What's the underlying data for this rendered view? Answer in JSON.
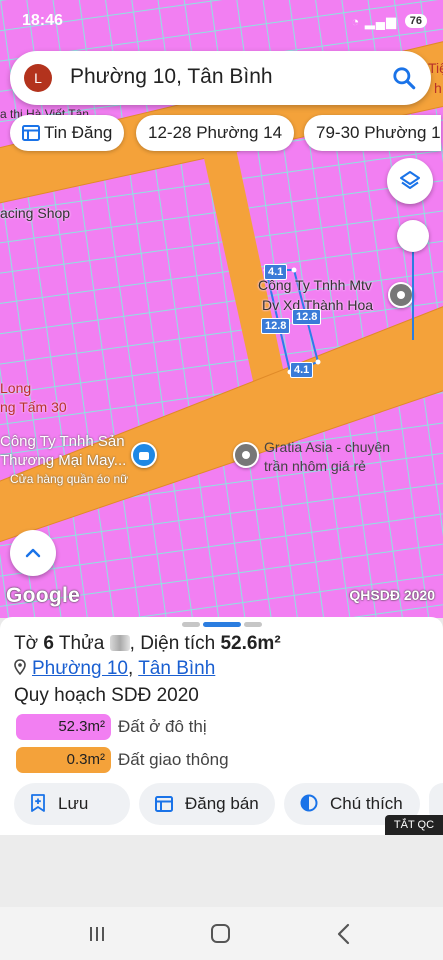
{
  "status_bar": {
    "time": "18:46",
    "battery": "76"
  },
  "search": {
    "avatar_letter": "L",
    "query": "Phường 10, Tân Bình"
  },
  "chips": [
    {
      "label": "Tin Đăng",
      "icon": "listing-icon"
    },
    {
      "label": "12-28 Phường 14"
    },
    {
      "label": "79-30 Phường 1"
    }
  ],
  "map": {
    "labels": {
      "street_top": "a thị Hà Viết Tân",
      "racing_shop": "acing Shop",
      "company_1_line1": "Công Ty Tnhh Mtv",
      "company_1_line2": "Dv Xd Thành Hoa",
      "long": "Long",
      "com_tam": "ng Tấm 30",
      "company_2_line1": "Công Ty Tnhh Sản",
      "company_2_line2": "Thương Mại May...",
      "clothes_shop": "Cửa hàng quần áo nữ",
      "gratia_line1": "Gratia Asia - chuyên",
      "gratia_line2": "trần nhôm giá rẻ",
      "edge_top": "Tiệ",
      "edge_mid": "h"
    },
    "dimensions": {
      "top": "4.1",
      "left": "12.8",
      "right": "12.8",
      "bottom": "4.1"
    },
    "google_logo": "Google",
    "layer_badge": "QHSDĐ 2020"
  },
  "sheet": {
    "to_label": "Tờ",
    "to_number": "6",
    "thua_label": "Thửa",
    "area_label": "Diện tích",
    "area_value": "52.6m²",
    "ward": "Phường 10",
    "separator": ",",
    "district": "Tân Bình",
    "plan_title": "Quy hoạch SDĐ 2020",
    "land_uses": [
      {
        "area": "52.3m²",
        "label": "Đất ở đô thị",
        "color": "#f27ff2"
      },
      {
        "area": "0.3m²",
        "label": "Đất giao thông",
        "color": "#f4a23a"
      }
    ],
    "actions": [
      {
        "label": "Lưu",
        "icon": "bookmark-add-icon"
      },
      {
        "label": "Đăng bán",
        "icon": "listing-icon"
      },
      {
        "label": "Chú thích",
        "icon": "contrast-icon"
      }
    ],
    "ad_close": "TẮT QC"
  },
  "colors": {
    "residential": "#f27ff2",
    "road": "#f4a23a",
    "accent_blue": "#1a73e8",
    "parcel_border": "#7fe8e4"
  }
}
